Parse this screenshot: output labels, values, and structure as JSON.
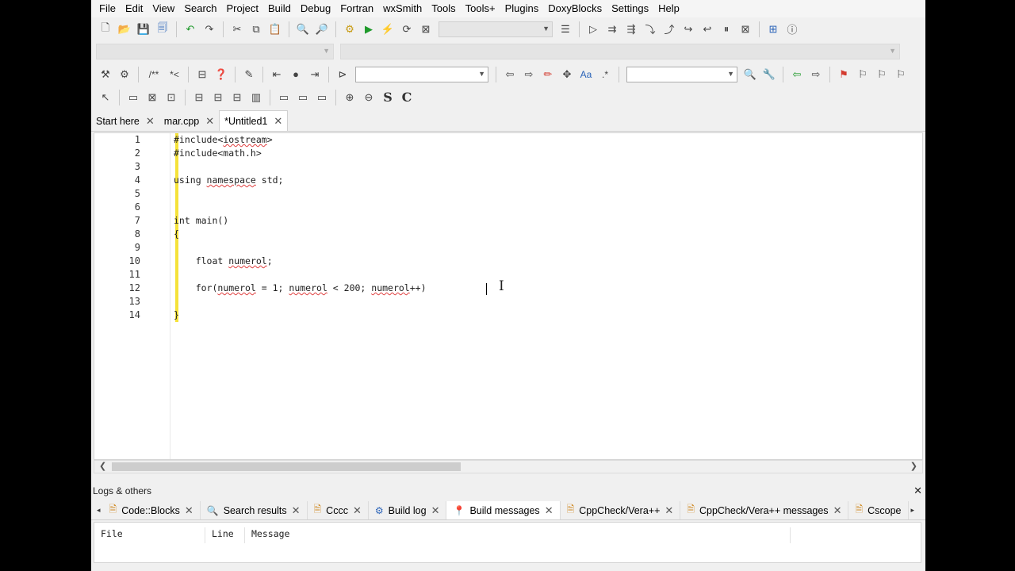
{
  "menu": [
    "File",
    "Edit",
    "View",
    "Search",
    "Project",
    "Build",
    "Debug",
    "Fortran",
    "wxSmith",
    "Tools",
    "Tools+",
    "Plugins",
    "DoxyBlocks",
    "Settings",
    "Help"
  ],
  "toolbar_text": {
    "comment_block": "/**",
    "comment_inline": "*<",
    "regex": ".*",
    "font_icon": "Aa",
    "s_button": "S",
    "c_button": "C"
  },
  "tabs": [
    {
      "label": "Start here",
      "closable": true,
      "active": false
    },
    {
      "label": "mar.cpp",
      "closable": true,
      "active": false
    },
    {
      "label": "*Untitled1",
      "closable": true,
      "active": true
    }
  ],
  "editor": {
    "lines": [
      {
        "num": "1",
        "text": "#include<iostream>"
      },
      {
        "num": "2",
        "text": "#include<math.h>"
      },
      {
        "num": "3",
        "text": ""
      },
      {
        "num": "4",
        "text": "using namespace std;"
      },
      {
        "num": "5",
        "text": ""
      },
      {
        "num": "6",
        "text": ""
      },
      {
        "num": "7",
        "text": "int main()"
      },
      {
        "num": "8",
        "text": "{"
      },
      {
        "num": "9",
        "text": ""
      },
      {
        "num": "10",
        "text": "    float numerol;"
      },
      {
        "num": "11",
        "text": ""
      },
      {
        "num": "12",
        "text": "    for(numerol = 1; numerol < 200; numerol++)"
      },
      {
        "num": "13",
        "text": ""
      },
      {
        "num": "14",
        "text": "}"
      }
    ]
  },
  "logs": {
    "title": "Logs & others",
    "tabs": [
      {
        "label": "Code::Blocks",
        "icon": "page-icon",
        "active": false
      },
      {
        "label": "Search results",
        "icon": "search-icon",
        "active": false
      },
      {
        "label": "Cccc",
        "icon": "page-icon",
        "active": false
      },
      {
        "label": "Build log",
        "icon": "gear-icon",
        "active": false
      },
      {
        "label": "Build messages",
        "icon": "pin-icon",
        "active": true
      },
      {
        "label": "CppCheck/Vera++",
        "icon": "page-icon",
        "active": false
      },
      {
        "label": "CppCheck/Vera++ messages",
        "icon": "page-icon",
        "active": false
      },
      {
        "label": "Cscope",
        "icon": "page-icon",
        "active": false
      }
    ],
    "columns": [
      "File",
      "Line",
      "Message"
    ]
  },
  "colors": {
    "change_bar": "#f5e23a",
    "squiggle": "#e04040",
    "run_green": "#1f9a2b"
  }
}
